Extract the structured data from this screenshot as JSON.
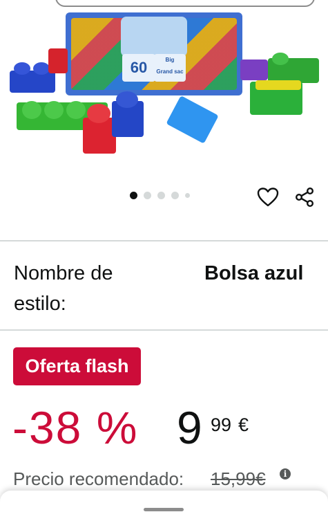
{
  "product_image": {
    "alt": "Fisher-Price Mega Bloks 60 bloques bolsa azul",
    "box_count": "60",
    "box_big": "Big",
    "box_grand": "Grand sac"
  },
  "carousel": {
    "total_images": 5,
    "active_index": 0
  },
  "actions": {
    "wishlist_icon": "heart-outline-icon",
    "share_icon": "share-icon"
  },
  "style": {
    "label": "Nombre de estilo:",
    "value": "Bolsa azul"
  },
  "deal": {
    "badge_label": "Oferta flash",
    "badge_color": "#cc0c39"
  },
  "price": {
    "discount": "-38 %",
    "whole": "9",
    "fraction": "99",
    "currency": "€",
    "discount_color": "#cc0c39"
  },
  "recommended": {
    "label": "Precio recomendado:",
    "value": "15,99€"
  },
  "bottom_sheet": {
    "handle_icon": "drag-handle-icon"
  }
}
